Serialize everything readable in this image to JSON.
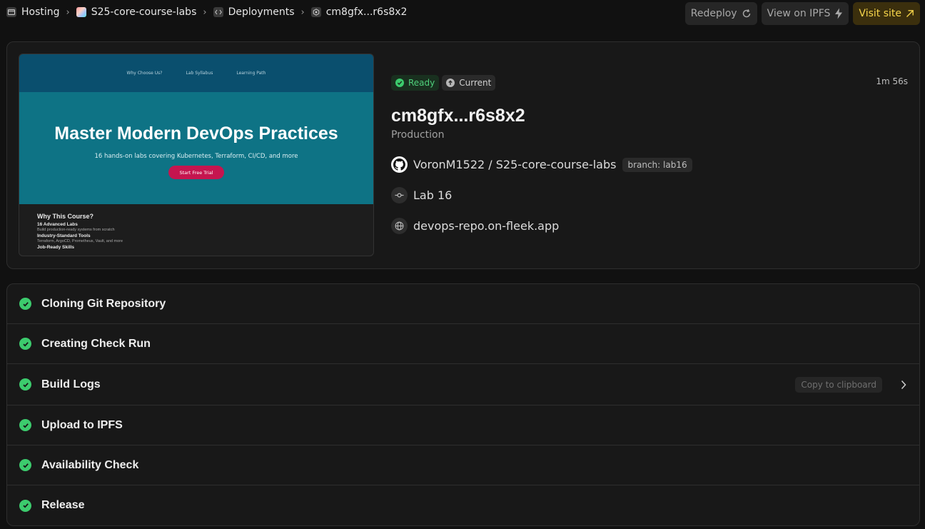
{
  "breadcrumb": {
    "items": [
      {
        "label": "Hosting",
        "icon": "hosting-icon"
      },
      {
        "label": "S25-core-course-labs",
        "icon": "project-avatar-icon"
      },
      {
        "label": "Deployments",
        "icon": "code-icon"
      },
      {
        "label": "cm8gfx...r6s8x2",
        "icon": "deployment-icon"
      }
    ]
  },
  "actions": {
    "redeploy": "Redeploy",
    "view_ipfs": "View on IPFS",
    "visit_site": "Visit site"
  },
  "preview": {
    "nav": [
      "Why Choose Us?",
      "Lab Syllabus",
      "Learning Path"
    ],
    "title": "Master Modern DevOps Practices",
    "subtitle": "16 hands-on labs covering Kubernetes, Terraform, CI/CD, and more",
    "cta": "Start Free Trial",
    "section_title": "Why This Course?",
    "features": [
      {
        "title": "16 Advanced Labs",
        "desc": "Build production-ready systems from scratch"
      },
      {
        "title": "Industry-Standard Tools",
        "desc": "Terraform, ArgoCD, Prometheus, Vault, and more"
      },
      {
        "title": "Job-Ready Skills",
        "desc": ""
      }
    ]
  },
  "deployment": {
    "status": "Ready",
    "tag": "Current",
    "elapsed": "1m 56s",
    "id": "cm8gfx...r6s8x2",
    "environment": "Production",
    "repo": "VoronM1522 / S25-core-course-labs",
    "branch": "branch: lab16",
    "commit": "Lab 16",
    "domain": "devops-repo.on-fleek.app"
  },
  "steps": [
    {
      "label": "Cloning Git Repository",
      "status": "success"
    },
    {
      "label": "Creating Check Run",
      "status": "success"
    },
    {
      "label": "Build Logs",
      "status": "success",
      "copy_label": "Copy to clipboard"
    },
    {
      "label": "Upload to IPFS",
      "status": "success"
    },
    {
      "label": "Availability Check",
      "status": "success"
    },
    {
      "label": "Release",
      "status": "success"
    }
  ],
  "colors": {
    "background": "#111111",
    "success": "#3ccb6d",
    "visit_accent": "#f7d54a"
  }
}
